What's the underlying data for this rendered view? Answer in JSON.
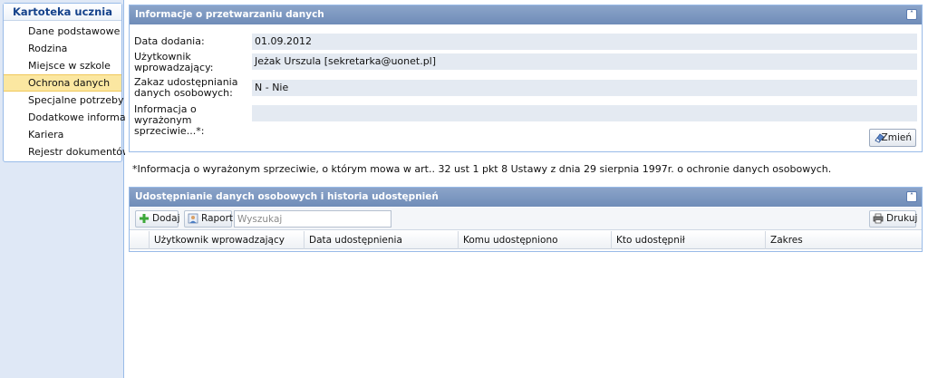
{
  "sidebar": {
    "title": "Kartoteka ucznia",
    "items": [
      {
        "label": "Dane podstawowe",
        "active": false
      },
      {
        "label": "Rodzina",
        "active": false
      },
      {
        "label": "Miejsce w szkole",
        "active": false
      },
      {
        "label": "Ochrona danych",
        "active": true
      },
      {
        "label": "Specjalne potrzeby",
        "active": false
      },
      {
        "label": "Dodatkowe informacje",
        "active": false
      },
      {
        "label": "Kariera",
        "active": false
      },
      {
        "label": "Rejestr dokumentów",
        "active": false
      }
    ]
  },
  "info_panel": {
    "title": "Informacje o przetwarzaniu danych",
    "fields": [
      {
        "label": "Data dodania:",
        "value": "01.09.2012"
      },
      {
        "label": "Użytkownik wprowadzający:",
        "value": "Jeżak Urszula [sekretarka@uonet.pl]"
      },
      {
        "label": "Zakaz udostępniania danych osobowych:",
        "value": "N - Nie"
      },
      {
        "label": "Informacja o wyrażonym sprzeciwie...*:",
        "value": ""
      }
    ],
    "edit_label": "Zmień"
  },
  "footnote": "*Informacja o wyrażonym sprzeciwie, o którym mowa w art.. 32 ust 1 pkt 8 Ustawy z dnia 29 sierpnia 1997r. o ochronie danych osobowych.",
  "share_panel": {
    "title": "Udostępnianie danych osobowych i historia udostępnień",
    "toolbar": {
      "add_label": "Dodaj",
      "report_label": "Raport",
      "search_placeholder": "Wyszukaj",
      "print_label": "Drukuj"
    },
    "columns": [
      "Użytkownik wprowadzający",
      "Data udostępnienia",
      "Komu udostępniono",
      "Kto udostępnił",
      "Zakres"
    ]
  },
  "colors": {
    "header_blue": "#7a96c0",
    "active_item": "#fbe7a1",
    "field_bg": "#e4eaf2"
  }
}
